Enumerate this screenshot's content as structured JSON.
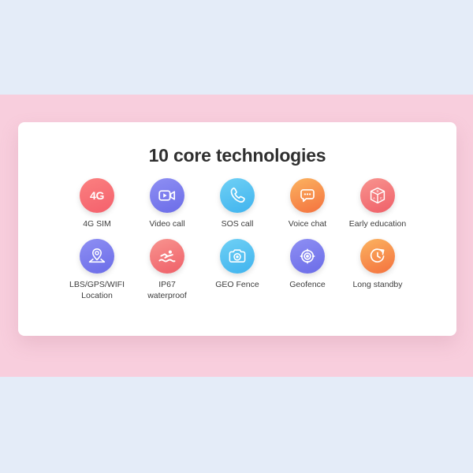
{
  "background": {
    "top_band_color": "#e4ecf8",
    "middle_band_color": "#f8cedd",
    "bottom_band_color": "#e4ecf8"
  },
  "card": {
    "background_color": "#ffffff",
    "title": "10 core technologies"
  },
  "features": {
    "rows": [
      [
        {
          "label": "4G SIM",
          "icon": "4g-sim-icon",
          "icon_text": "4G",
          "color": "#f4606c",
          "gradient_class": "g-coral"
        },
        {
          "label": "Video call",
          "icon": "video-camera-icon",
          "icon_text": "",
          "color": "#6b6ce8",
          "gradient_class": "g-purple"
        },
        {
          "label": "SOS call",
          "icon": "phone-handset-icon",
          "icon_text": "",
          "color": "#3fb3ee",
          "gradient_class": "g-blue"
        },
        {
          "label": "Voice chat",
          "icon": "speech-bubble-icon",
          "icon_text": "",
          "color": "#f4713e",
          "gradient_class": "g-orange"
        },
        {
          "label": "Early education",
          "icon": "abc-block-icon",
          "icon_text": "",
          "color": "#ef5f68",
          "gradient_class": "g-rose"
        }
      ],
      [
        {
          "label": "LBS/GPS/WIFI\nLocation",
          "icon": "location-pin-icon",
          "icon_text": "",
          "color": "#6b6ce8",
          "gradient_class": "g-purple"
        },
        {
          "label": "IP67\nwaterproof",
          "icon": "swimmer-icon",
          "icon_text": "",
          "color": "#ef5f68",
          "gradient_class": "g-rose"
        },
        {
          "label": "GEO Fence",
          "icon": "camera-icon",
          "icon_text": "",
          "color": "#3fb3ee",
          "gradient_class": "g-blue"
        },
        {
          "label": "Geofence",
          "icon": "target-crosshair-icon",
          "icon_text": "",
          "color": "#6b6ce8",
          "gradient_class": "g-purple"
        },
        {
          "label": "Long standby",
          "icon": "clock-refresh-icon",
          "icon_text": "",
          "color": "#f4713e",
          "gradient_class": "g-orange"
        }
      ]
    ]
  }
}
